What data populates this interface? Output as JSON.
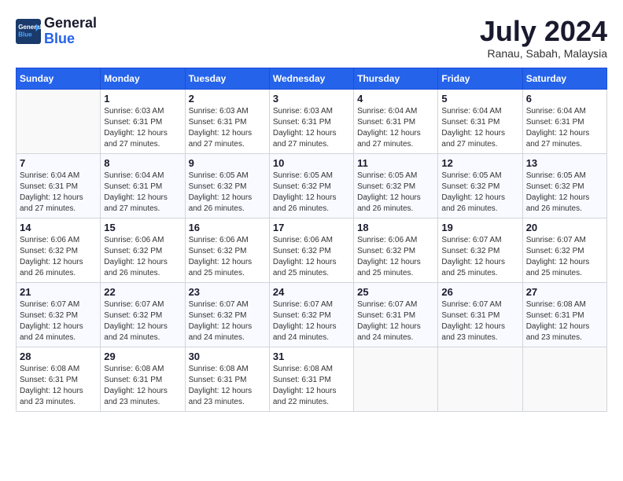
{
  "header": {
    "logo_line1": "General",
    "logo_line2": "Blue",
    "month_year": "July 2024",
    "location": "Ranau, Sabah, Malaysia"
  },
  "days_of_week": [
    "Sunday",
    "Monday",
    "Tuesday",
    "Wednesday",
    "Thursday",
    "Friday",
    "Saturday"
  ],
  "weeks": [
    [
      {
        "day": null
      },
      {
        "day": 1,
        "sunrise": "6:03 AM",
        "sunset": "6:31 PM",
        "daylight": "12 hours and 27 minutes."
      },
      {
        "day": 2,
        "sunrise": "6:03 AM",
        "sunset": "6:31 PM",
        "daylight": "12 hours and 27 minutes."
      },
      {
        "day": 3,
        "sunrise": "6:03 AM",
        "sunset": "6:31 PM",
        "daylight": "12 hours and 27 minutes."
      },
      {
        "day": 4,
        "sunrise": "6:04 AM",
        "sunset": "6:31 PM",
        "daylight": "12 hours and 27 minutes."
      },
      {
        "day": 5,
        "sunrise": "6:04 AM",
        "sunset": "6:31 PM",
        "daylight": "12 hours and 27 minutes."
      },
      {
        "day": 6,
        "sunrise": "6:04 AM",
        "sunset": "6:31 PM",
        "daylight": "12 hours and 27 minutes."
      }
    ],
    [
      {
        "day": 7,
        "sunrise": "6:04 AM",
        "sunset": "6:31 PM",
        "daylight": "12 hours and 27 minutes."
      },
      {
        "day": 8,
        "sunrise": "6:04 AM",
        "sunset": "6:31 PM",
        "daylight": "12 hours and 27 minutes."
      },
      {
        "day": 9,
        "sunrise": "6:05 AM",
        "sunset": "6:32 PM",
        "daylight": "12 hours and 26 minutes."
      },
      {
        "day": 10,
        "sunrise": "6:05 AM",
        "sunset": "6:32 PM",
        "daylight": "12 hours and 26 minutes."
      },
      {
        "day": 11,
        "sunrise": "6:05 AM",
        "sunset": "6:32 PM",
        "daylight": "12 hours and 26 minutes."
      },
      {
        "day": 12,
        "sunrise": "6:05 AM",
        "sunset": "6:32 PM",
        "daylight": "12 hours and 26 minutes."
      },
      {
        "day": 13,
        "sunrise": "6:05 AM",
        "sunset": "6:32 PM",
        "daylight": "12 hours and 26 minutes."
      }
    ],
    [
      {
        "day": 14,
        "sunrise": "6:06 AM",
        "sunset": "6:32 PM",
        "daylight": "12 hours and 26 minutes."
      },
      {
        "day": 15,
        "sunrise": "6:06 AM",
        "sunset": "6:32 PM",
        "daylight": "12 hours and 26 minutes."
      },
      {
        "day": 16,
        "sunrise": "6:06 AM",
        "sunset": "6:32 PM",
        "daylight": "12 hours and 25 minutes."
      },
      {
        "day": 17,
        "sunrise": "6:06 AM",
        "sunset": "6:32 PM",
        "daylight": "12 hours and 25 minutes."
      },
      {
        "day": 18,
        "sunrise": "6:06 AM",
        "sunset": "6:32 PM",
        "daylight": "12 hours and 25 minutes."
      },
      {
        "day": 19,
        "sunrise": "6:07 AM",
        "sunset": "6:32 PM",
        "daylight": "12 hours and 25 minutes."
      },
      {
        "day": 20,
        "sunrise": "6:07 AM",
        "sunset": "6:32 PM",
        "daylight": "12 hours and 25 minutes."
      }
    ],
    [
      {
        "day": 21,
        "sunrise": "6:07 AM",
        "sunset": "6:32 PM",
        "daylight": "12 hours and 24 minutes."
      },
      {
        "day": 22,
        "sunrise": "6:07 AM",
        "sunset": "6:32 PM",
        "daylight": "12 hours and 24 minutes."
      },
      {
        "day": 23,
        "sunrise": "6:07 AM",
        "sunset": "6:32 PM",
        "daylight": "12 hours and 24 minutes."
      },
      {
        "day": 24,
        "sunrise": "6:07 AM",
        "sunset": "6:32 PM",
        "daylight": "12 hours and 24 minutes."
      },
      {
        "day": 25,
        "sunrise": "6:07 AM",
        "sunset": "6:31 PM",
        "daylight": "12 hours and 24 minutes."
      },
      {
        "day": 26,
        "sunrise": "6:07 AM",
        "sunset": "6:31 PM",
        "daylight": "12 hours and 23 minutes."
      },
      {
        "day": 27,
        "sunrise": "6:08 AM",
        "sunset": "6:31 PM",
        "daylight": "12 hours and 23 minutes."
      }
    ],
    [
      {
        "day": 28,
        "sunrise": "6:08 AM",
        "sunset": "6:31 PM",
        "daylight": "12 hours and 23 minutes."
      },
      {
        "day": 29,
        "sunrise": "6:08 AM",
        "sunset": "6:31 PM",
        "daylight": "12 hours and 23 minutes."
      },
      {
        "day": 30,
        "sunrise": "6:08 AM",
        "sunset": "6:31 PM",
        "daylight": "12 hours and 23 minutes."
      },
      {
        "day": 31,
        "sunrise": "6:08 AM",
        "sunset": "6:31 PM",
        "daylight": "12 hours and 22 minutes."
      },
      {
        "day": null
      },
      {
        "day": null
      },
      {
        "day": null
      }
    ]
  ]
}
